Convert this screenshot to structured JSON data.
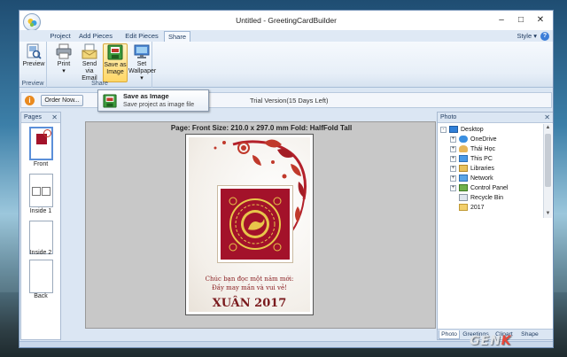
{
  "window": {
    "title": "Untitled - GreetingCardBuilder"
  },
  "tabs": [
    {
      "label": "Project"
    },
    {
      "label": "Add Pieces"
    },
    {
      "label": "Edit Pieces"
    },
    {
      "label": "Share"
    }
  ],
  "style_menu": "Style",
  "ribbon": {
    "groups": [
      {
        "title": "Preview",
        "buttons": [
          {
            "label": "Preview"
          }
        ]
      },
      {
        "title": "Share",
        "buttons": [
          {
            "label": "Print"
          },
          {
            "label": "Send via Email",
            "l1": "Send",
            "l2": "via Email"
          },
          {
            "label": "Save as Image",
            "l1": "Save as",
            "l2": "Image"
          },
          {
            "label": "Set Wallpaper",
            "l1": "Set",
            "l2": "Wallpaper"
          }
        ]
      }
    ]
  },
  "infobar": {
    "order_button": "Order Now...",
    "trial_text": "Trial Version(15 Days Left)"
  },
  "tooltip": {
    "title": "Save as Image",
    "description": "Save project as image file"
  },
  "pages_panel": {
    "title": "Pages",
    "pages": [
      {
        "label": "Front"
      },
      {
        "label": "Inside 1"
      },
      {
        "label": "Inside 2"
      },
      {
        "label": "Back"
      }
    ]
  },
  "canvas": {
    "page_info": "Page: Front  Size: 210.0 x 297.0 mm   Fold: HalfFold Tall",
    "card": {
      "greeting_line1": "Chúc bạn đọc một năm mới:",
      "greeting_line2": "Đầy may mắn và vui vẻ!",
      "big_text": "XUÂN 2017"
    }
  },
  "photo_panel": {
    "title": "Photo",
    "tree": [
      {
        "label": "Desktop",
        "level": 0,
        "expander": "-"
      },
      {
        "label": "OneDrive",
        "level": 1,
        "expander": "+"
      },
      {
        "label": "Thái Học",
        "level": 1,
        "expander": "+"
      },
      {
        "label": "This PC",
        "level": 1,
        "expander": "+"
      },
      {
        "label": "Libraries",
        "level": 1,
        "expander": "+"
      },
      {
        "label": "Network",
        "level": 1,
        "expander": "+"
      },
      {
        "label": "Control Panel",
        "level": 1,
        "expander": "+"
      },
      {
        "label": "Recycle Bin",
        "level": 1,
        "expander": ""
      },
      {
        "label": "2017",
        "level": 1,
        "expander": ""
      }
    ],
    "tabs": [
      {
        "label": "Photo"
      },
      {
        "label": "Greetings"
      },
      {
        "label": "Clipart"
      },
      {
        "label": "Shape"
      }
    ]
  },
  "watermark": {
    "text_a": "GEN",
    "text_b": "K"
  },
  "colors": {
    "accent": "#3b7dd8",
    "card_red": "#a3122a",
    "gold": "#e8c64a"
  }
}
